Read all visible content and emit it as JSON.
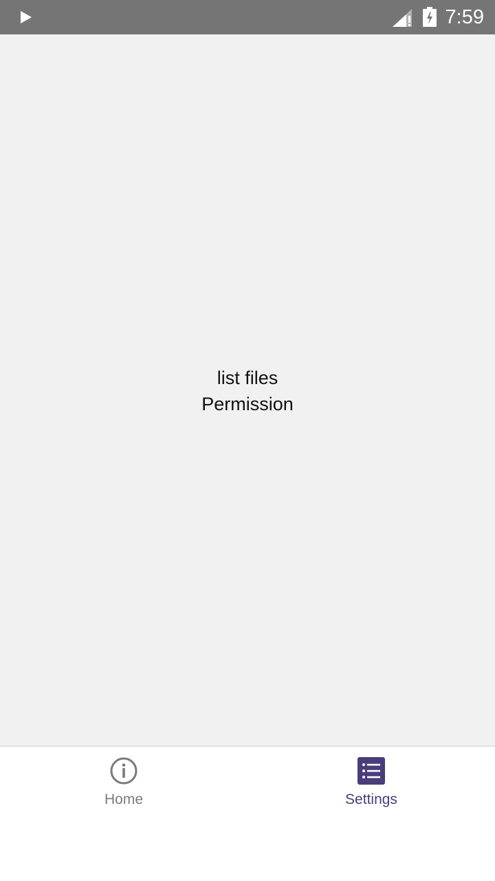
{
  "status_bar": {
    "time": "7:59",
    "icons": [
      "play-icon",
      "signal-icon",
      "battery-charging-icon"
    ]
  },
  "main": {
    "line1": "list files",
    "line2": "Permission"
  },
  "bottom_nav": {
    "items": [
      {
        "label": "Home",
        "icon": "info-icon",
        "active": false
      },
      {
        "label": "Settings",
        "icon": "list-icon",
        "active": true
      }
    ]
  },
  "colors": {
    "status_bar": "#757575",
    "background": "#f1f1f1",
    "active": "#4a3d7a",
    "inactive": "#7a7a7a"
  }
}
